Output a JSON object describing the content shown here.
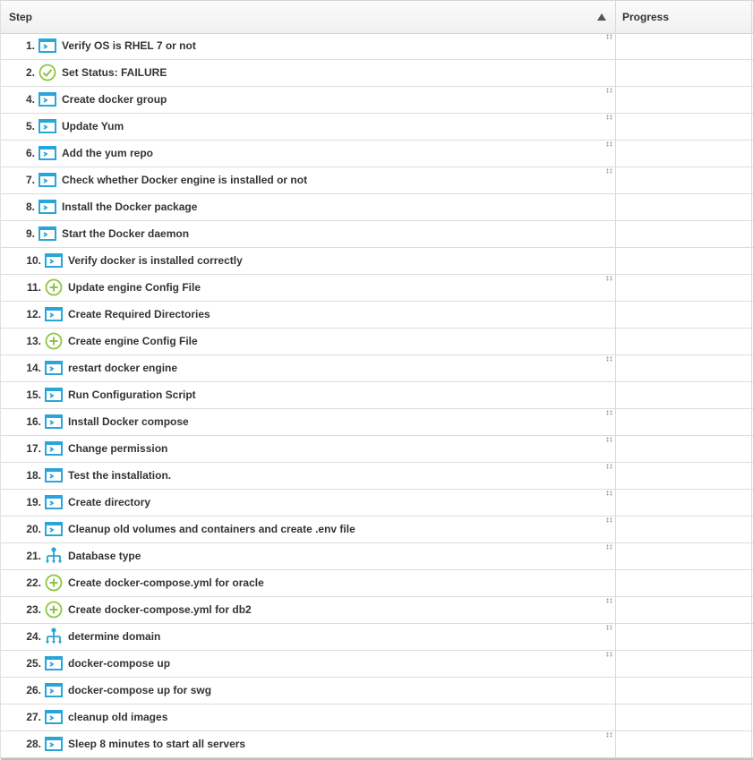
{
  "header": {
    "step_label": "Step",
    "progress_label": "Progress",
    "sort_icon": "sort-ascending-triangle"
  },
  "colors": {
    "accent_blue": "#2aa5d8",
    "success_green": "#8cc63f",
    "row_border": "#dcdcdc"
  },
  "steps": [
    {
      "num": "1.",
      "icon": "script",
      "label": "Verify OS is RHEL 7 or not",
      "handle": true
    },
    {
      "num": "2.",
      "icon": "check",
      "label": "Set Status: FAILURE",
      "handle": false
    },
    {
      "num": "4.",
      "icon": "script",
      "label": "Create docker group",
      "handle": true
    },
    {
      "num": "5.",
      "icon": "script",
      "label": "Update Yum",
      "handle": true
    },
    {
      "num": "6.",
      "icon": "script",
      "label": "Add the yum repo",
      "handle": true
    },
    {
      "num": "7.",
      "icon": "script",
      "label": "Check whether Docker engine is installed or not",
      "handle": true
    },
    {
      "num": "8.",
      "icon": "script",
      "label": "Install the Docker package",
      "handle": false
    },
    {
      "num": "9.",
      "icon": "script",
      "label": "Start the Docker daemon",
      "handle": false
    },
    {
      "num": "10.",
      "icon": "script",
      "label": "Verify docker is installed correctly",
      "handle": false
    },
    {
      "num": "11.",
      "icon": "plus",
      "label": "Update engine Config File",
      "handle": true
    },
    {
      "num": "12.",
      "icon": "script",
      "label": "Create Required Directories",
      "handle": false
    },
    {
      "num": "13.",
      "icon": "plus",
      "label": "Create engine Config File",
      "handle": false
    },
    {
      "num": "14.",
      "icon": "script",
      "label": "restart docker engine",
      "handle": true
    },
    {
      "num": "15.",
      "icon": "script",
      "label": "Run Configuration Script",
      "handle": false
    },
    {
      "num": "16.",
      "icon": "script",
      "label": "Install Docker compose",
      "handle": true
    },
    {
      "num": "17.",
      "icon": "script",
      "label": "Change permission",
      "handle": true
    },
    {
      "num": "18.",
      "icon": "script",
      "label": "Test the installation.",
      "handle": true
    },
    {
      "num": "19.",
      "icon": "script",
      "label": "Create directory",
      "handle": true
    },
    {
      "num": "20.",
      "icon": "script",
      "label": "Cleanup old volumes and containers and create .env file",
      "handle": true
    },
    {
      "num": "21.",
      "icon": "branch",
      "label": "Database type",
      "handle": true
    },
    {
      "num": "22.",
      "icon": "plus",
      "label": "Create docker-compose.yml for oracle",
      "handle": false
    },
    {
      "num": "23.",
      "icon": "plus",
      "label": "Create docker-compose.yml for db2",
      "handle": true
    },
    {
      "num": "24.",
      "icon": "branch",
      "label": "determine domain",
      "handle": true
    },
    {
      "num": "25.",
      "icon": "script",
      "label": "docker-compose up",
      "handle": true
    },
    {
      "num": "26.",
      "icon": "script",
      "label": "docker-compose up for swg",
      "handle": false
    },
    {
      "num": "27.",
      "icon": "script",
      "label": "cleanup old images",
      "handle": false
    },
    {
      "num": "28.",
      "icon": "script",
      "label": "Sleep 8 minutes to start all servers",
      "handle": true
    }
  ]
}
